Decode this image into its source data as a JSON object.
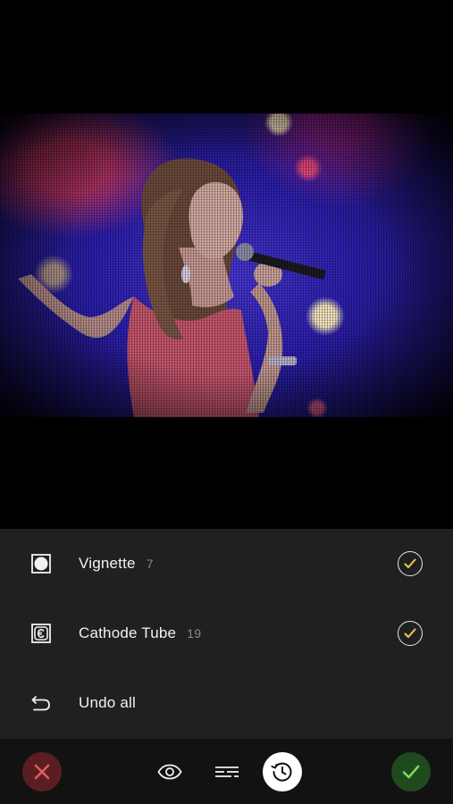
{
  "photo": {
    "subject": "singer-with-microphone"
  },
  "history": {
    "items": [
      {
        "label": "Vignette",
        "count": "7",
        "icon": "vignette-icon",
        "checked": true
      },
      {
        "label": "Cathode Tube",
        "count": "19",
        "icon": "cathode-tube-icon",
        "checked": true
      }
    ],
    "undo_label": "Undo all"
  },
  "toolbar": {
    "cancel_icon": "close-icon",
    "preview_icon": "eye-icon",
    "adjust_icon": "sliders-icon",
    "history_icon": "history-icon",
    "apply_icon": "checkmark-icon"
  },
  "colors": {
    "accent_check": "#f2c94c",
    "cancel": "#e05a5f",
    "apply": "#7ed957",
    "panel_bg": "#202020",
    "toolbar_bg": "#121212"
  }
}
